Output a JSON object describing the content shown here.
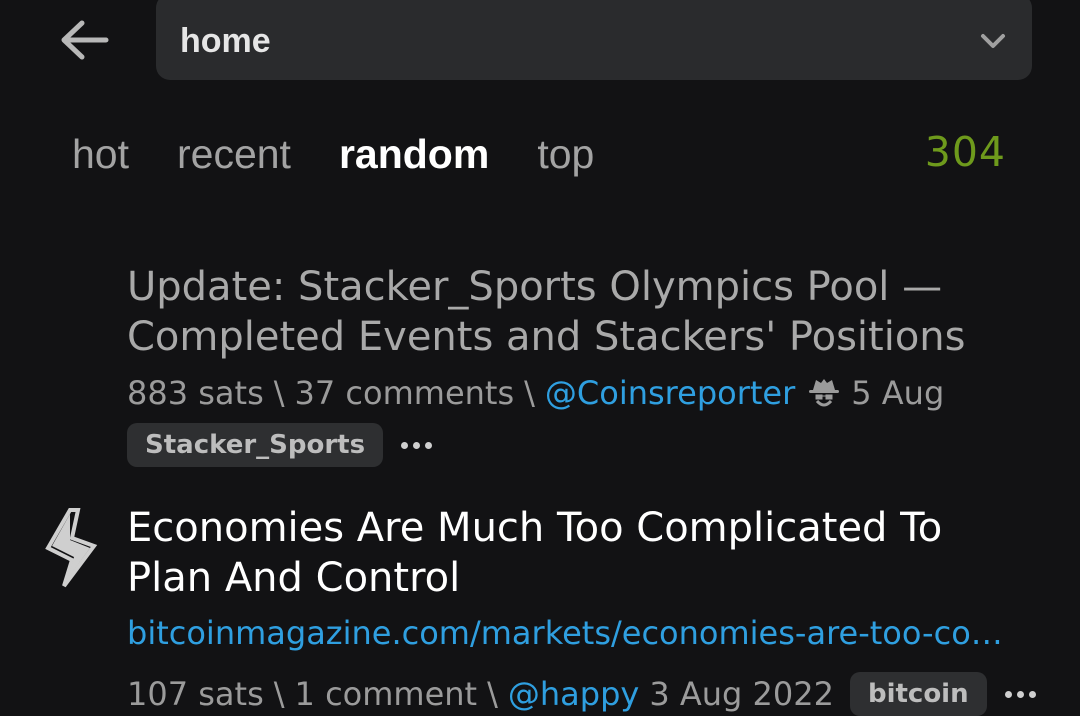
{
  "header": {
    "sub_value": "home",
    "back_icon": "arrow-left-icon",
    "dropdown_icon": "chevron-down-icon"
  },
  "tabs": [
    {
      "label": "hot"
    },
    {
      "label": "recent"
    },
    {
      "label": "random",
      "active": true
    },
    {
      "label": "top"
    }
  ],
  "count": "304",
  "items": [
    {
      "title": "Update: Stacker_Sports Olympics Pool — Completed Events and Stackers' Positions",
      "sats": "883 sats",
      "comments": "37 comments",
      "user": "@Coinsreporter",
      "date": "5 Aug",
      "tag": "Stacker_Sports"
    },
    {
      "title": "Economies Are Much Too Complicated To Plan And Control",
      "link": "bitcoinmagazine.com/markets/economies-are-too-complicated-to-plan-and-control",
      "sats": "107 sats",
      "comments": "1 comment",
      "user": "@happy",
      "date": "3 Aug 2022",
      "tag": "bitcoin"
    }
  ],
  "colors": {
    "background": "#121214",
    "accent_link": "#2f9fe0",
    "count": "#6e9a1c"
  }
}
